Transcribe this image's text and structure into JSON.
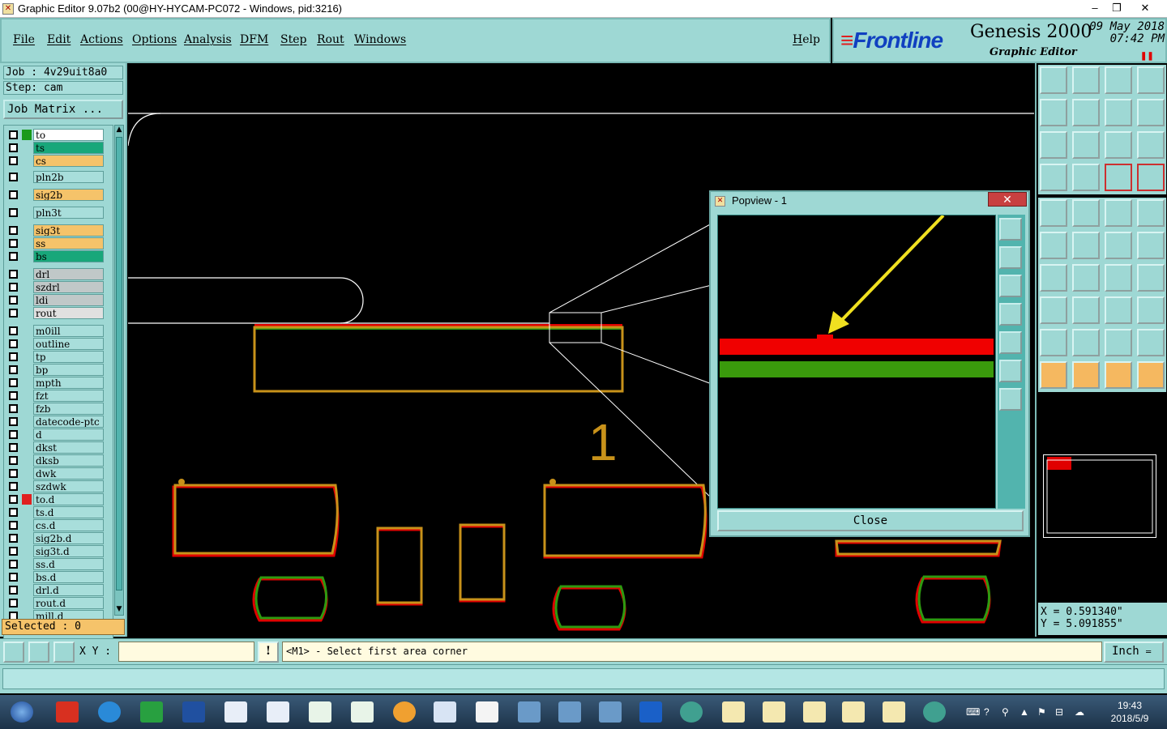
{
  "window": {
    "title": "Graphic Editor 9.07b2 (00@HY-HYCAM-PC072 - Windows, pid:3216)",
    "minimize": "–",
    "maximize": "❐",
    "close": "✕"
  },
  "menu": {
    "items": [
      "File",
      "Edit",
      "Actions",
      "Options",
      "Analysis",
      "DFM",
      "Step",
      "Rout",
      "Windows"
    ],
    "help": "Help"
  },
  "brand": {
    "logo": "Frontline",
    "product": "Genesis 2000",
    "subtitle": "Graphic Editor",
    "date": "09 May 2018",
    "time": "07:42 PM",
    "pause_glyph": "❚❚"
  },
  "job": {
    "job_label": "Job : 4v29uit8a0",
    "step_label": "Step: cam",
    "matrix_button": "Job Matrix ..."
  },
  "layers": [
    {
      "name": "to",
      "color": "#ffffff",
      "swatch": "#1a9a1a"
    },
    {
      "name": "ts",
      "color": "#18a77a",
      "swatch": ""
    },
    {
      "name": "cs",
      "color": "#f5c36a",
      "swatch": ""
    },
    {
      "name": "pln2b",
      "color": "#a8dedb",
      "swatch": ""
    },
    {
      "name": "sig2b",
      "color": "#f5c36a",
      "swatch": ""
    },
    {
      "name": "pln3t",
      "color": "#a8dedb",
      "swatch": ""
    },
    {
      "name": "sig3t",
      "color": "#f5c36a",
      "swatch": ""
    },
    {
      "name": "ss",
      "color": "#f5c36a",
      "swatch": ""
    },
    {
      "name": "bs",
      "color": "#18a77a",
      "swatch": ""
    },
    {
      "name": "drl",
      "color": "#c0c8c8",
      "swatch": ""
    },
    {
      "name": "szdrl",
      "color": "#c0c8c8",
      "swatch": ""
    },
    {
      "name": "ldi",
      "color": "#c0c8c8",
      "swatch": ""
    },
    {
      "name": "rout",
      "color": "#e0e0e0",
      "swatch": ""
    },
    {
      "name": "m0ill",
      "color": "#a8dedb",
      "swatch": ""
    },
    {
      "name": "outline",
      "color": "#a8dedb",
      "swatch": ""
    },
    {
      "name": "tp",
      "color": "#a8dedb",
      "swatch": ""
    },
    {
      "name": "bp",
      "color": "#a8dedb",
      "swatch": ""
    },
    {
      "name": "mpth",
      "color": "#a8dedb",
      "swatch": ""
    },
    {
      "name": "fzt",
      "color": "#a8dedb",
      "swatch": ""
    },
    {
      "name": "fzb",
      "color": "#a8dedb",
      "swatch": ""
    },
    {
      "name": "datecode-ptc",
      "color": "#a8dedb",
      "swatch": ""
    },
    {
      "name": "d",
      "color": "#a8dedb",
      "swatch": ""
    },
    {
      "name": "dkst",
      "color": "#a8dedb",
      "swatch": ""
    },
    {
      "name": "dksb",
      "color": "#a8dedb",
      "swatch": ""
    },
    {
      "name": "dwk",
      "color": "#a8dedb",
      "swatch": ""
    },
    {
      "name": "szdwk",
      "color": "#a8dedb",
      "swatch": ""
    },
    {
      "name": "to.d",
      "color": "#a8dedb",
      "swatch": "#e02020"
    },
    {
      "name": "ts.d",
      "color": "#a8dedb",
      "swatch": ""
    },
    {
      "name": "cs.d",
      "color": "#a8dedb",
      "swatch": ""
    },
    {
      "name": "sig2b.d",
      "color": "#a8dedb",
      "swatch": ""
    },
    {
      "name": "sig3t.d",
      "color": "#a8dedb",
      "swatch": ""
    },
    {
      "name": "ss.d",
      "color": "#a8dedb",
      "swatch": ""
    },
    {
      "name": "bs.d",
      "color": "#a8dedb",
      "swatch": ""
    },
    {
      "name": "drl.d",
      "color": "#a8dedb",
      "swatch": ""
    },
    {
      "name": "rout.d",
      "color": "#a8dedb",
      "swatch": ""
    },
    {
      "name": "mill.d",
      "color": "#a8dedb",
      "swatch": ""
    }
  ],
  "selected_label": "Selected : 0",
  "canvas": {
    "label_1": "1"
  },
  "popview": {
    "title": "Popview - 1",
    "close_x": "✕",
    "close_button": "Close"
  },
  "coords": {
    "x": "X = 0.591340\"",
    "y": "Y = 5.091855\""
  },
  "command": {
    "xy_label": "X Y :",
    "xy_value": "",
    "bang": "!",
    "prompt": "<M1> - Select first area corner",
    "unit": "Inch"
  },
  "taskbar": {
    "time": "19:43",
    "date": "2018/5/9"
  }
}
